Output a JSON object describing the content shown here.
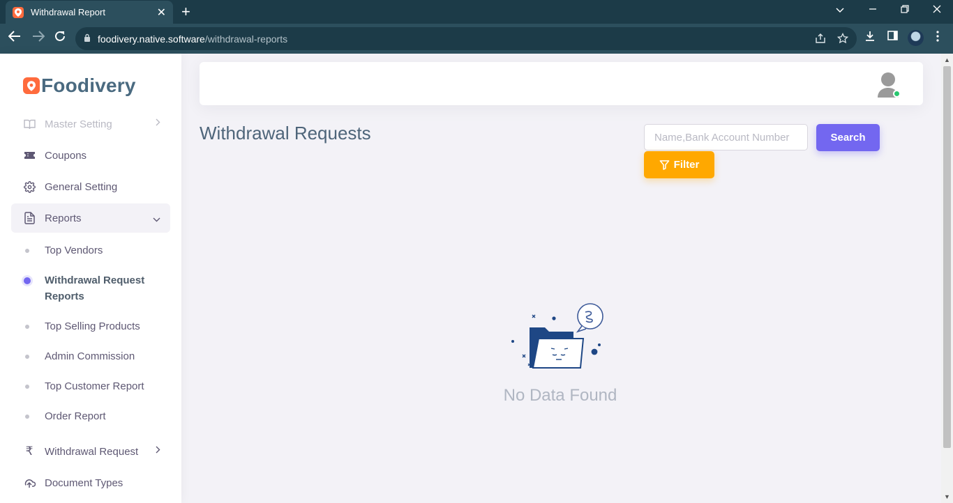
{
  "browser": {
    "tab_title": "Withdrawal Report",
    "url_host": "foodivery.native.software",
    "url_path": "/withdrawal-reports"
  },
  "sidebar": {
    "brand": "Foodivery",
    "items": [
      {
        "label": "Master Setting",
        "icon": "book-icon",
        "has_chevron": true,
        "faded": true
      },
      {
        "label": "Coupons",
        "icon": "ticket-icon"
      },
      {
        "label": "General Setting",
        "icon": "gear-icon"
      },
      {
        "label": "Reports",
        "icon": "file-text-icon",
        "expanded": true
      }
    ],
    "report_subitems": [
      {
        "label": "Top Vendors"
      },
      {
        "label": "Withdrawal Request Reports",
        "active": true
      },
      {
        "label": "Top Selling Products"
      },
      {
        "label": "Admin Commission"
      },
      {
        "label": "Top Customer Report"
      },
      {
        "label": "Order Report"
      }
    ],
    "bottom_items": [
      {
        "label": "Withdrawal Request",
        "icon": "rupee-icon",
        "has_chevron": true
      },
      {
        "label": "Document Types",
        "icon": "cloud-upload-icon"
      }
    ]
  },
  "main": {
    "title": "Withdrawal Requests",
    "search_placeholder": "Name,Bank Account Number",
    "search_button": "Search",
    "filter_button": "Filter",
    "empty_message": "No Data Found"
  },
  "colors": {
    "primary": "#7367f0",
    "warning": "#ffa800",
    "brand": "#ff6b3d",
    "online": "#28c76f"
  }
}
